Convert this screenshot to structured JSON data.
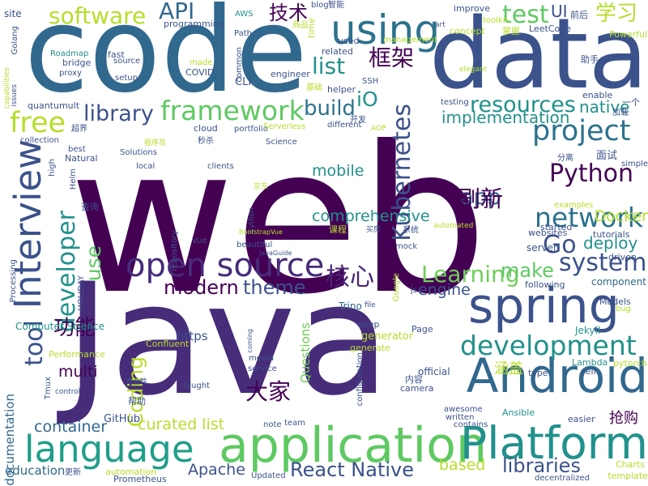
{
  "words": [
    {
      "text": "web",
      "color": "#440154"
    },
    {
      "text": "Java",
      "color": "#472c7a"
    },
    {
      "text": "code",
      "color": "#31688e"
    },
    {
      "text": "data",
      "color": "#3b528b"
    },
    {
      "text": "Android",
      "color": "#31688e"
    },
    {
      "text": "application",
      "color": "#5ec962"
    },
    {
      "text": "spring",
      "color": "#3b528b"
    },
    {
      "text": "Platform",
      "color": "#21918c"
    },
    {
      "text": "language",
      "color": "#1f9e89"
    },
    {
      "text": "Interview",
      "color": "#3b528b"
    },
    {
      "text": "using",
      "color": "#2c728e"
    },
    {
      "text": "open source",
      "color": "#472c7a"
    },
    {
      "text": "project",
      "color": "#2c728e"
    },
    {
      "text": "development",
      "color": "#21918c"
    },
    {
      "text": "framework",
      "color": "#5ec962"
    },
    {
      "text": "network",
      "color": "#2c728e"
    },
    {
      "text": "free",
      "color": "#b5de2b"
    },
    {
      "text": "Python",
      "color": "#440154"
    },
    {
      "text": "system",
      "color": "#3b528b"
    },
    {
      "text": "Kubernetes",
      "color": "#3b528b"
    },
    {
      "text": "developer",
      "color": "#21918c"
    },
    {
      "text": "Learning",
      "color": "#6ece58"
    },
    {
      "text": "library",
      "color": "#3b528b"
    },
    {
      "text": "resources",
      "color": "#21918c"
    },
    {
      "text": "tool",
      "color": "#3b528b"
    },
    {
      "text": "software",
      "color": "#b5de2b"
    },
    {
      "text": "test",
      "color": "#5ec962"
    },
    {
      "text": "build",
      "color": "#2c728e"
    },
    {
      "text": "React Native",
      "color": "#3b528b"
    },
    {
      "text": "libraries",
      "color": "#3b528b"
    },
    {
      "text": "Go",
      "color": "#3b528b"
    },
    {
      "text": "app",
      "color": "#31688e"
    },
    {
      "text": "核心",
      "color": "#482374"
    },
    {
      "text": "框架",
      "color": "#440154"
    },
    {
      "text": "刷新",
      "color": "#440154"
    },
    {
      "text": "学习",
      "color": "#b5de2b"
    },
    {
      "text": "API",
      "color": "#31688e"
    },
    {
      "text": "list",
      "color": "#21918c"
    },
    {
      "text": "theme",
      "color": "#3b528b"
    },
    {
      "text": "modern",
      "color": "#440154"
    },
    {
      "text": "make",
      "color": "#5ec962"
    },
    {
      "text": "Coding",
      "color": "#b5de2b"
    },
    {
      "text": "iO",
      "color": "#21918c"
    },
    {
      "text": "功能",
      "color": "#440154"
    },
    {
      "text": "Docker",
      "color": "#b5de2b"
    },
    {
      "text": "use",
      "color": "#5ec962"
    },
    {
      "text": "mobile",
      "color": "#21918c"
    },
    {
      "text": "comprehensive",
      "color": "#21918c"
    },
    {
      "text": "deploy",
      "color": "#21918c"
    },
    {
      "text": "native",
      "color": "#21918c"
    },
    {
      "text": "implementation",
      "color": "#21918c"
    },
    {
      "text": "技术",
      "color": "#440154"
    },
    {
      "text": "UI",
      "color": "#3b528b"
    },
    {
      "text": "container",
      "color": "#31688e"
    },
    {
      "text": "curated list",
      "color": "#b5de2b"
    },
    {
      "text": "Apache",
      "color": "#3b528b"
    },
    {
      "text": "based",
      "color": "#b5de2b"
    },
    {
      "text": "multi",
      "color": "#440154"
    },
    {
      "text": "engine",
      "color": "#3b528b"
    },
    {
      "text": "大家",
      "color": "#440154"
    },
    {
      "text": "抢购",
      "color": "#440154"
    },
    {
      "text": "涵盖",
      "color": "#b5de2b"
    },
    {
      "text": "documentation",
      "color": "#31688e"
    },
    {
      "text": "education",
      "color": "#31688e"
    },
    {
      "text": "Questions",
      "color": "#6ece58"
    },
    {
      "text": "GitHub",
      "color": "#3b528b"
    },
    {
      "text": "https",
      "color": "#3b528b"
    },
    {
      "text": "Computer Science",
      "color": "#21918c"
    },
    {
      "text": "Confluent",
      "color": "#b5de2b"
    },
    {
      "text": "Performance",
      "color": "#b5de2b"
    },
    {
      "text": "generator",
      "color": "#b5de2b"
    },
    {
      "text": "generate",
      "color": "#b5de2b"
    },
    {
      "text": "deep",
      "color": "#3b528b"
    },
    {
      "text": "Page",
      "color": "#3b528b"
    },
    {
      "text": "Jekyll",
      "color": "#21918c"
    },
    {
      "text": "Trino",
      "color": "#31688e"
    },
    {
      "text": "official",
      "color": "#3b528b"
    },
    {
      "text": "camera",
      "color": "#3b528b"
    },
    {
      "text": "内容",
      "color": "#3b528b"
    },
    {
      "text": "Lambda",
      "color": "#21918c"
    },
    {
      "text": "pytorch",
      "color": "#b5de2b"
    },
    {
      "text": "self",
      "color": "#3b528b"
    },
    {
      "text": "type",
      "color": "#3b528b"
    },
    {
      "text": "Models",
      "color": "#3b528b"
    },
    {
      "text": "bug",
      "color": "#b5de2b"
    },
    {
      "text": "component",
      "color": "#31688e"
    },
    {
      "text": "following",
      "color": "#3b528b"
    },
    {
      "text": "driven",
      "color": "#3b528b"
    },
    {
      "text": "server",
      "color": "#3b528b"
    },
    {
      "text": "tutorials",
      "color": "#3b528b"
    },
    {
      "text": "websites",
      "color": "#3b528b"
    },
    {
      "text": "started",
      "color": "#3b528b"
    },
    {
      "text": "examples",
      "color": "#b5de2b"
    },
    {
      "text": "simple",
      "color": "#3b528b"
    },
    {
      "text": "面试",
      "color": "#3b528b"
    },
    {
      "text": "分离",
      "color": "#3b528b"
    },
    {
      "text": "加载",
      "color": "#3b528b"
    },
    {
      "text": "一个",
      "color": "#3b528b"
    },
    {
      "text": "enable",
      "color": "#3b528b"
    },
    {
      "text": "助手",
      "color": "#3b528b"
    },
    {
      "text": "Powerful",
      "color": "#b5de2b"
    },
    {
      "text": "LeetCode",
      "color": "#3b528b"
    },
    {
      "text": "前后",
      "color": "#3b528b"
    },
    {
      "text": "掌握",
      "color": "#b5de2b"
    },
    {
      "text": "toolkit",
      "color": "#b5de2b"
    },
    {
      "text": "improve",
      "color": "#3b528b"
    },
    {
      "text": "concept",
      "color": "#b5de2b"
    },
    {
      "text": "management",
      "color": "#b5de2b"
    },
    {
      "text": "used",
      "color": "#3b528b"
    },
    {
      "text": "blog",
      "color": "#3b528b"
    },
    {
      "text": "智能",
      "color": "#3b528b"
    },
    {
      "text": "art",
      "color": "#3b528b"
    },
    {
      "text": "elegant",
      "color": "#b5de2b"
    },
    {
      "text": "related",
      "color": "#3b528b"
    },
    {
      "text": "time",
      "color": "#b5de2b"
    },
    {
      "text": "商品",
      "color": "#b5de2b"
    },
    {
      "text": "AWS",
      "color": "#21918c"
    },
    {
      "text": "site",
      "color": "#3b528b"
    },
    {
      "text": "Golang",
      "color": "#3b528b"
    },
    {
      "text": "programming",
      "color": "#3b528b"
    },
    {
      "text": "Path",
      "color": "#3b528b"
    },
    {
      "text": "fast",
      "color": "#3b528b"
    },
    {
      "text": "source",
      "color": "#3b528b"
    },
    {
      "text": "Roadmap",
      "color": "#21918c"
    },
    {
      "text": "bridge",
      "color": "#3b528b"
    },
    {
      "text": "made",
      "color": "#b5de2b"
    },
    {
      "text": "COVID",
      "color": "#3b528b"
    },
    {
      "text": "proxy",
      "color": "#3b528b"
    },
    {
      "text": "setup",
      "color": "#3b528b"
    },
    {
      "text": "common",
      "color": "#3b528b"
    },
    {
      "text": "CLI",
      "color": "#3b528b"
    },
    {
      "text": "engineer",
      "color": "#3b528b"
    },
    {
      "text": "SSH",
      "color": "#3b528b"
    },
    {
      "text": "基础",
      "color": "#b5de2b"
    },
    {
      "text": "helper",
      "color": "#3b528b"
    },
    {
      "text": "testing",
      "color": "#3b528b"
    },
    {
      "text": "开发",
      "color": "#3b528b"
    },
    {
      "text": "AOP",
      "color": "#b5de2b"
    },
    {
      "text": "different",
      "color": "#3b528b"
    },
    {
      "text": "portfolio",
      "color": "#3b528b"
    },
    {
      "text": "cloud",
      "color": "#3b528b"
    },
    {
      "text": "Serverless",
      "color": "#b5de2b"
    },
    {
      "text": "Science",
      "color": "#3b528b"
    },
    {
      "text": "秒杀",
      "color": "#3b528b"
    },
    {
      "text": "local",
      "color": "#3b528b"
    },
    {
      "text": "clients",
      "color": "#3b528b"
    },
    {
      "text": "capabilities",
      "color": "#b5de2b"
    },
    {
      "text": "issues",
      "color": "#3b528b"
    },
    {
      "text": "quantumult",
      "color": "#3b528b"
    },
    {
      "text": "超界",
      "color": "#3b528b"
    },
    {
      "text": "collection",
      "color": "#3b528b"
    },
    {
      "text": "程序员",
      "color": "#b5de2b"
    },
    {
      "text": "best",
      "color": "#3b528b"
    },
    {
      "text": "Natural",
      "color": "#3b528b"
    },
    {
      "text": "Solutions",
      "color": "#3b528b"
    },
    {
      "text": "high",
      "color": "#3b528b"
    },
    {
      "text": "Helm",
      "color": "#3b528b"
    },
    {
      "text": "京东",
      "color": "#b5de2b"
    },
    {
      "text": "Cython",
      "color": "#3b528b"
    },
    {
      "text": "BootstrapVue",
      "color": "#b5de2b"
    },
    {
      "text": "课程",
      "color": "#b5de2b"
    },
    {
      "text": "买房",
      "color": "#3b528b"
    },
    {
      "text": "系统",
      "color": "#3b528b"
    },
    {
      "text": "automated",
      "color": "#b5de2b"
    },
    {
      "text": "查询",
      "color": "#3b528b"
    },
    {
      "text": "repository",
      "color": "#3b528b"
    },
    {
      "text": "Vue",
      "color": "#3b528b"
    },
    {
      "text": "beautiful",
      "color": "#3b528b"
    },
    {
      "text": "JavaGuide",
      "color": "#3b528b"
    },
    {
      "text": "mock",
      "color": "#3b528b"
    },
    {
      "text": "js",
      "color": "#3b528b"
    },
    {
      "text": "Google",
      "color": "#b5de2b"
    },
    {
      "text": "file",
      "color": "#3b528b"
    },
    {
      "text": "Processing",
      "color": "#3b528b"
    },
    {
      "text": "HOLIDAY",
      "color": "#3b528b"
    },
    {
      "text": "coming",
      "color": "#3b528b"
    },
    {
      "text": "media",
      "color": "#3b528b"
    },
    {
      "text": "service",
      "color": "#3b528b"
    },
    {
      "text": "专业性",
      "color": "#3b528b"
    },
    {
      "text": "taught",
      "color": "#3b528b"
    },
    {
      "text": "帮助",
      "color": "#3b528b"
    },
    {
      "text": "Tmux",
      "color": "#3b528b"
    },
    {
      "text": "control",
      "color": "#3b528b"
    },
    {
      "text": "note",
      "color": "#3b528b"
    },
    {
      "text": "team",
      "color": "#3b528b"
    },
    {
      "text": "configuration",
      "color": "#3b528b"
    },
    {
      "text": "awesome",
      "color": "#3b528b"
    },
    {
      "text": "written",
      "color": "#3b528b"
    },
    {
      "text": "contains",
      "color": "#3b528b"
    },
    {
      "text": "Ansible",
      "color": "#21918c"
    },
    {
      "text": "easier",
      "color": "#3b528b"
    },
    {
      "text": "Charts",
      "color": "#b5de2b"
    },
    {
      "text": "template",
      "color": "#b5de2b"
    },
    {
      "text": "decentralized",
      "color": "#3b528b"
    },
    {
      "text": "Updated",
      "color": "#3b528b"
    },
    {
      "text": "Prometheus",
      "color": "#3b528b"
    },
    {
      "text": "automation",
      "color": "#b5de2b"
    },
    {
      "text": "更新",
      "color": "#3b528b"
    }
  ]
}
